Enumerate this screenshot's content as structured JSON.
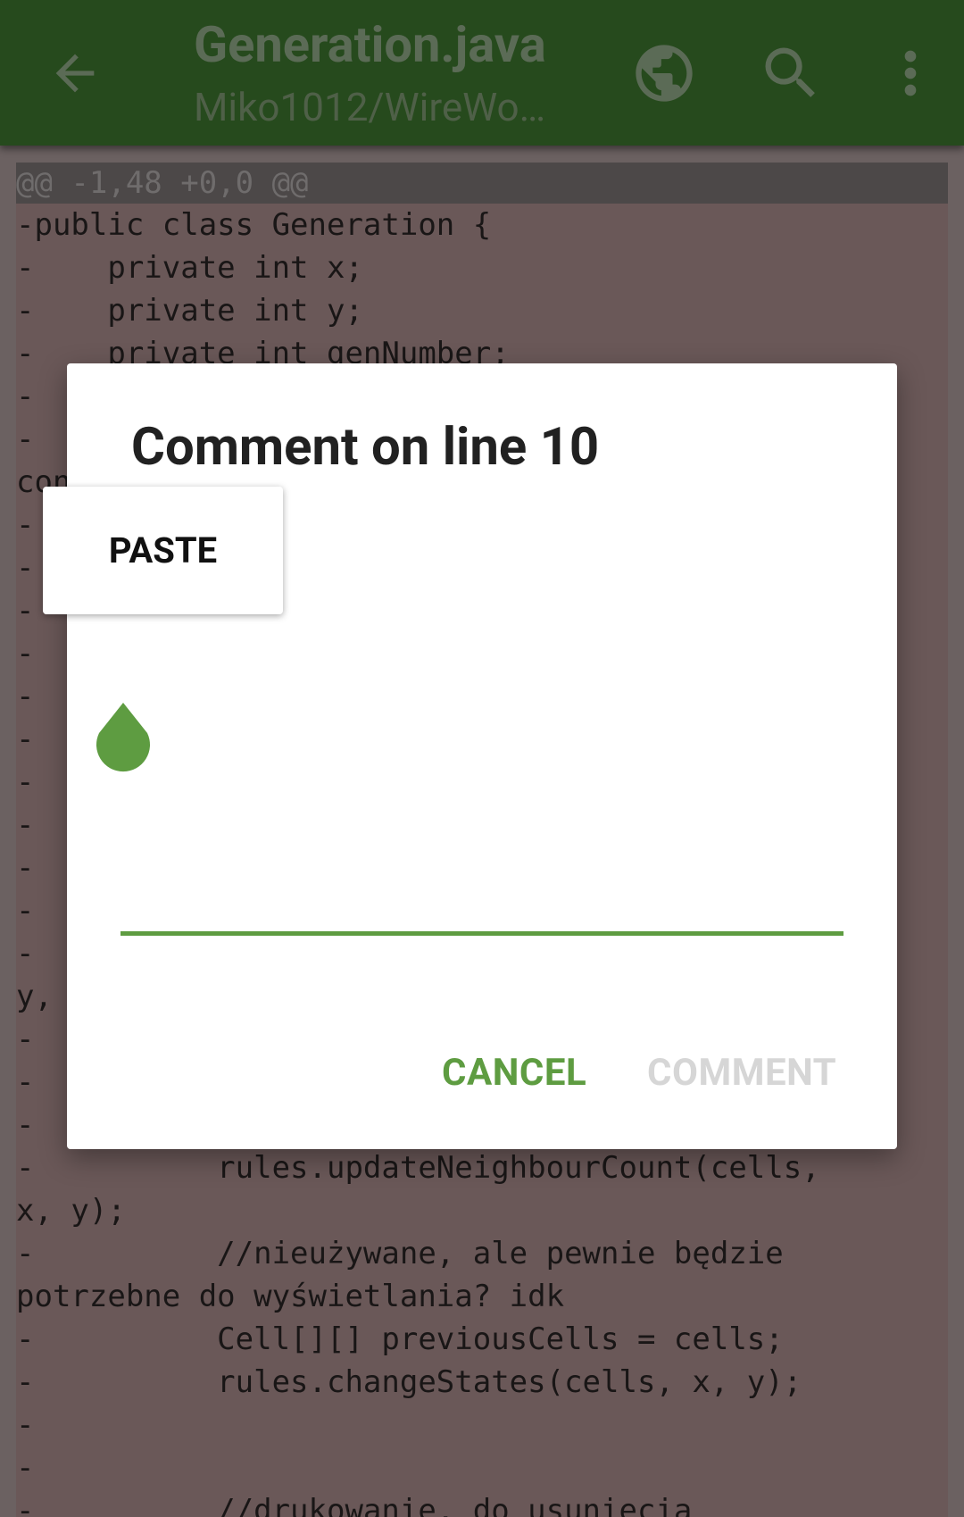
{
  "appbar": {
    "title": "Generation.java",
    "subtitle": "Miko1012/WireWo…",
    "back_icon": "arrow-left-icon",
    "browser_icon": "globe-icon",
    "search_icon": "search-icon",
    "menu_icon": "more-vert-icon",
    "background": "#264a1d"
  },
  "code": {
    "hunk_header": "@@ -1,48 +0,0 @@",
    "lines": [
      "-public class Generation {",
      "-    private int x;",
      "-    private int y;",
      "-    private int genNumber;",
      "-",
      "-",
      "con",
      "-",
      "-",
      "-                                          );",
      "-",
      "-",
      "-",
      "-",
      "-",
      "-",
      "-",
      "-                                         x,",
      "y,",
      "-",
      "-",
      "-",
      "-          rules.updateNeighbourCount(cells,",
      "x, y);",
      "-          //nieużywane, ale pewnie będzie",
      "potrzebne do wyświetlania? idk",
      "-          Cell[][] previousCells = cells;",
      "-          rules.changeStates(cells, x, y);",
      "-",
      "-",
      "-          //drukowanie, do usunięcia"
    ],
    "removed_bg": "#6a5858"
  },
  "dialog": {
    "title": "Comment on line 10",
    "input_value": "",
    "cancel_label": "CANCEL",
    "comment_label": "COMMENT",
    "accent": "#5e9c41"
  },
  "context_menu": {
    "paste_label": "PASTE"
  }
}
